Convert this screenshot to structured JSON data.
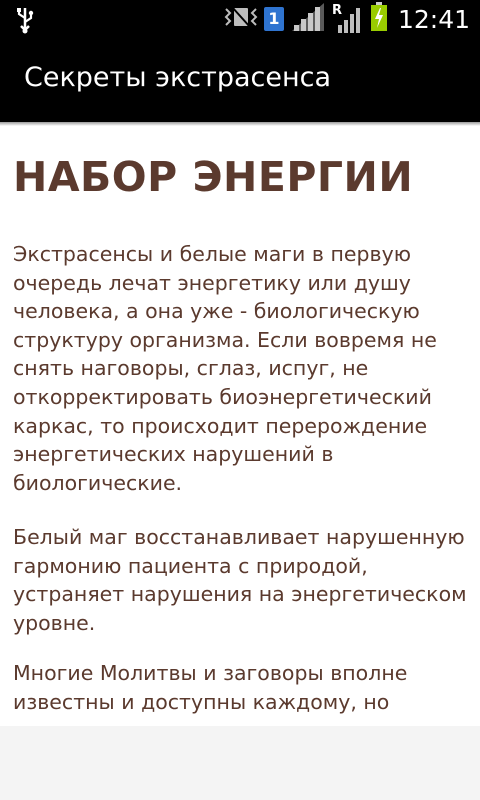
{
  "status_bar": {
    "time": "12:41",
    "sim_slot": "1",
    "roaming": "R",
    "icons": [
      "usb-icon",
      "vibrate-icon",
      "sim-1-icon",
      "signal-icon",
      "roaming-signal-icon",
      "battery-charging-icon"
    ]
  },
  "action_bar": {
    "title": "Секреты экстрасенса"
  },
  "article": {
    "heading": "НАБОР ЭНЕРГИИ",
    "paragraphs": [
      "Экстрасенсы и белые маги в первую очередь лечат энергетику или душу человека, а она уже - биологическую структуру организма. Если вовремя не снять наговоры, сглаз, испуг, не откорректировать биоэнергетический каркас, то происходит перерождение энергетических нарушений в биологические.",
      "Белый маг восстанавливает нарушенную гармонию пациента с природой, устраняет нарушения на энергетическом уровне.",
      "Многие Молитвы и заговоры вполне известны и доступны каждому, но"
    ]
  },
  "colors": {
    "text": "#5b3a2e",
    "bar_background": "#000000",
    "page_background": "#ffffff",
    "bottom_panel": "#f4f4f4"
  }
}
